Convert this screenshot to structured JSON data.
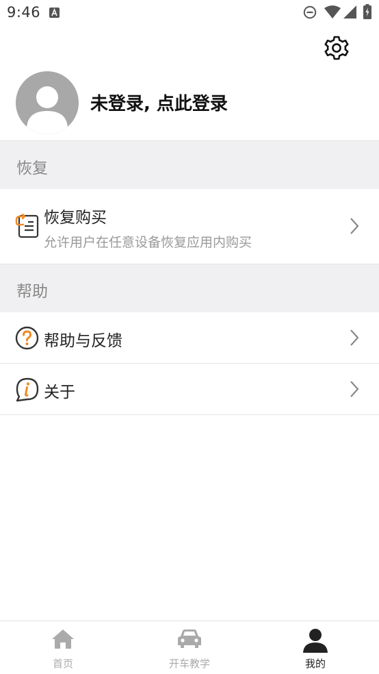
{
  "status_bar": {
    "time": "9:46",
    "icons": [
      "notification-a-icon",
      "do-not-disturb-icon",
      "wifi-icon",
      "cell-signal-icon",
      "battery-charging-icon"
    ]
  },
  "header": {
    "settings_icon": "gear-icon"
  },
  "profile": {
    "login_text": "未登录, 点此登录",
    "avatar_icon": "default-avatar-icon"
  },
  "sections": [
    {
      "header": "恢复",
      "items": [
        {
          "title": "恢复购买",
          "subtitle": "允许用户在任意设备恢复应用内购买",
          "icon": "restore-purchase-icon"
        }
      ]
    },
    {
      "header": "帮助",
      "items": [
        {
          "title": "帮助与反馈",
          "icon": "question-circle-icon"
        },
        {
          "title": "关于",
          "icon": "info-bubble-icon"
        }
      ]
    }
  ],
  "bottom_nav": {
    "items": [
      {
        "label": "首页",
        "icon": "home-icon",
        "active": false
      },
      {
        "label": "开车教学",
        "icon": "car-icon",
        "active": false
      },
      {
        "label": "我的",
        "icon": "person-icon",
        "active": true
      }
    ]
  },
  "colors": {
    "accent_orange": "#f08a24",
    "section_bg": "#f0f0f2",
    "inactive_nav": "#aaaaaa",
    "active_nav": "#222222",
    "avatar_gray": "#a8a8a8"
  }
}
